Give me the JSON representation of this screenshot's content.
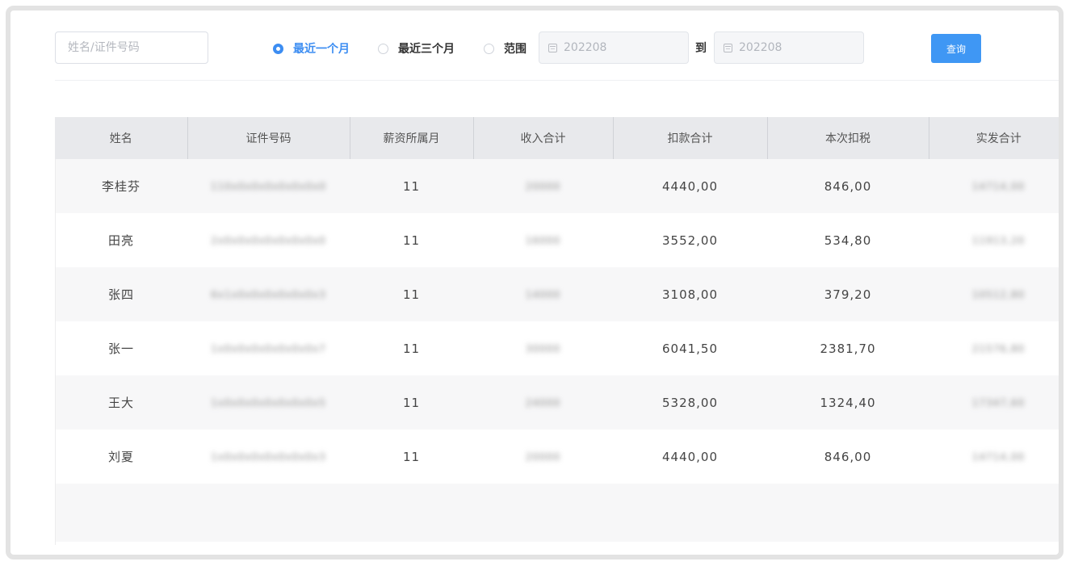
{
  "toolbar": {
    "search_placeholder": "姓名/证件号码",
    "radio_recent_one": "最近一个月",
    "radio_recent_three": "最近三个月",
    "radio_range": "范围",
    "date_from": "202208",
    "to_label": "到",
    "date_to": "202208",
    "query_label": "查询"
  },
  "table": {
    "headers": [
      "姓名",
      "证件号码",
      "薪资所属月",
      "收入合计",
      "扣款合计",
      "本次扣税",
      "实发合计"
    ],
    "rows": [
      {
        "name": "李桂芬",
        "id": "110x0x0x0x0x0x0x0",
        "month": "11",
        "income": "20000",
        "deduction": "4440,00",
        "tax": "846,00",
        "net": "14714,00"
      },
      {
        "name": "田亮",
        "id": "2x0x0x0x0x0x0x0x0",
        "month": "11",
        "income": "16000",
        "deduction": "3552,00",
        "tax": "534,80",
        "net": "11913,20"
      },
      {
        "name": "张四",
        "id": "6x1x0x0x0x0x0x0x3",
        "month": "11",
        "income": "14000",
        "deduction": "3108,00",
        "tax": "379,20",
        "net": "10512,80"
      },
      {
        "name": "张一",
        "id": "1x0x0x0x0x0x0x0x7",
        "month": "11",
        "income": "30000",
        "deduction": "6041,50",
        "tax": "2381,70",
        "net": "21576,80"
      },
      {
        "name": "王大",
        "id": "1x0x0x0x0x0x0x0x5",
        "month": "11",
        "income": "24000",
        "deduction": "5328,00",
        "tax": "1324,40",
        "net": "17347,60"
      },
      {
        "name": "刘夏",
        "id": "1x0x0x0x0x0x0x0x3",
        "month": "11",
        "income": "20000",
        "deduction": "4440,00",
        "tax": "846,00",
        "net": "14714,00"
      }
    ]
  },
  "icons": {
    "calendar": "calendar-icon"
  },
  "colors": {
    "accent": "#3c8df2",
    "button": "#3f97f4",
    "header_bg": "#e8e9ec"
  }
}
